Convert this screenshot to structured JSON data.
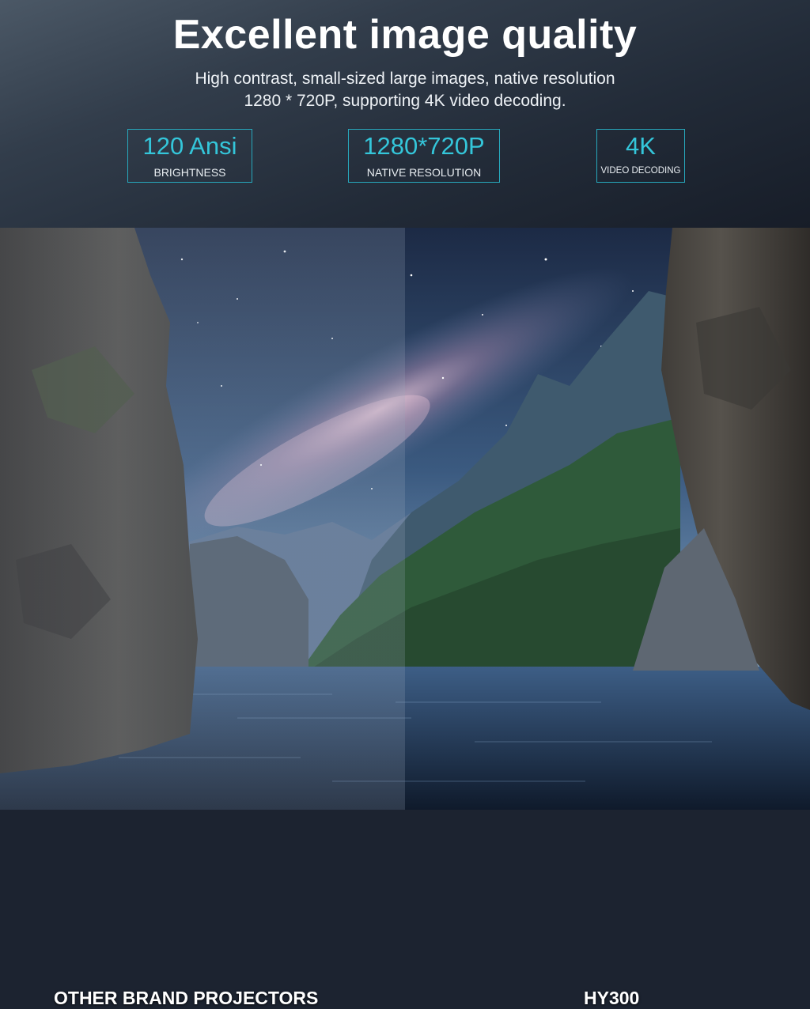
{
  "header": {
    "headline": "Excellent image quality",
    "subline_1": "High contrast, small-sized large images, native resolution",
    "subline_2": "1280 * 720P, supporting 4K video decoding."
  },
  "specs": [
    {
      "value": "120 Ansi",
      "label": "BRIGHTNESS"
    },
    {
      "value": "1280*720P",
      "label": "NATIVE RESOLUTION"
    },
    {
      "value": "4K",
      "label": "VIDEO DECODING"
    }
  ],
  "comparison": {
    "left_caption": "OTHER BRAND PROJECTORS",
    "right_caption": "HY300"
  },
  "colors": {
    "accent": "#34c6da",
    "header_bg": "#232c39"
  }
}
